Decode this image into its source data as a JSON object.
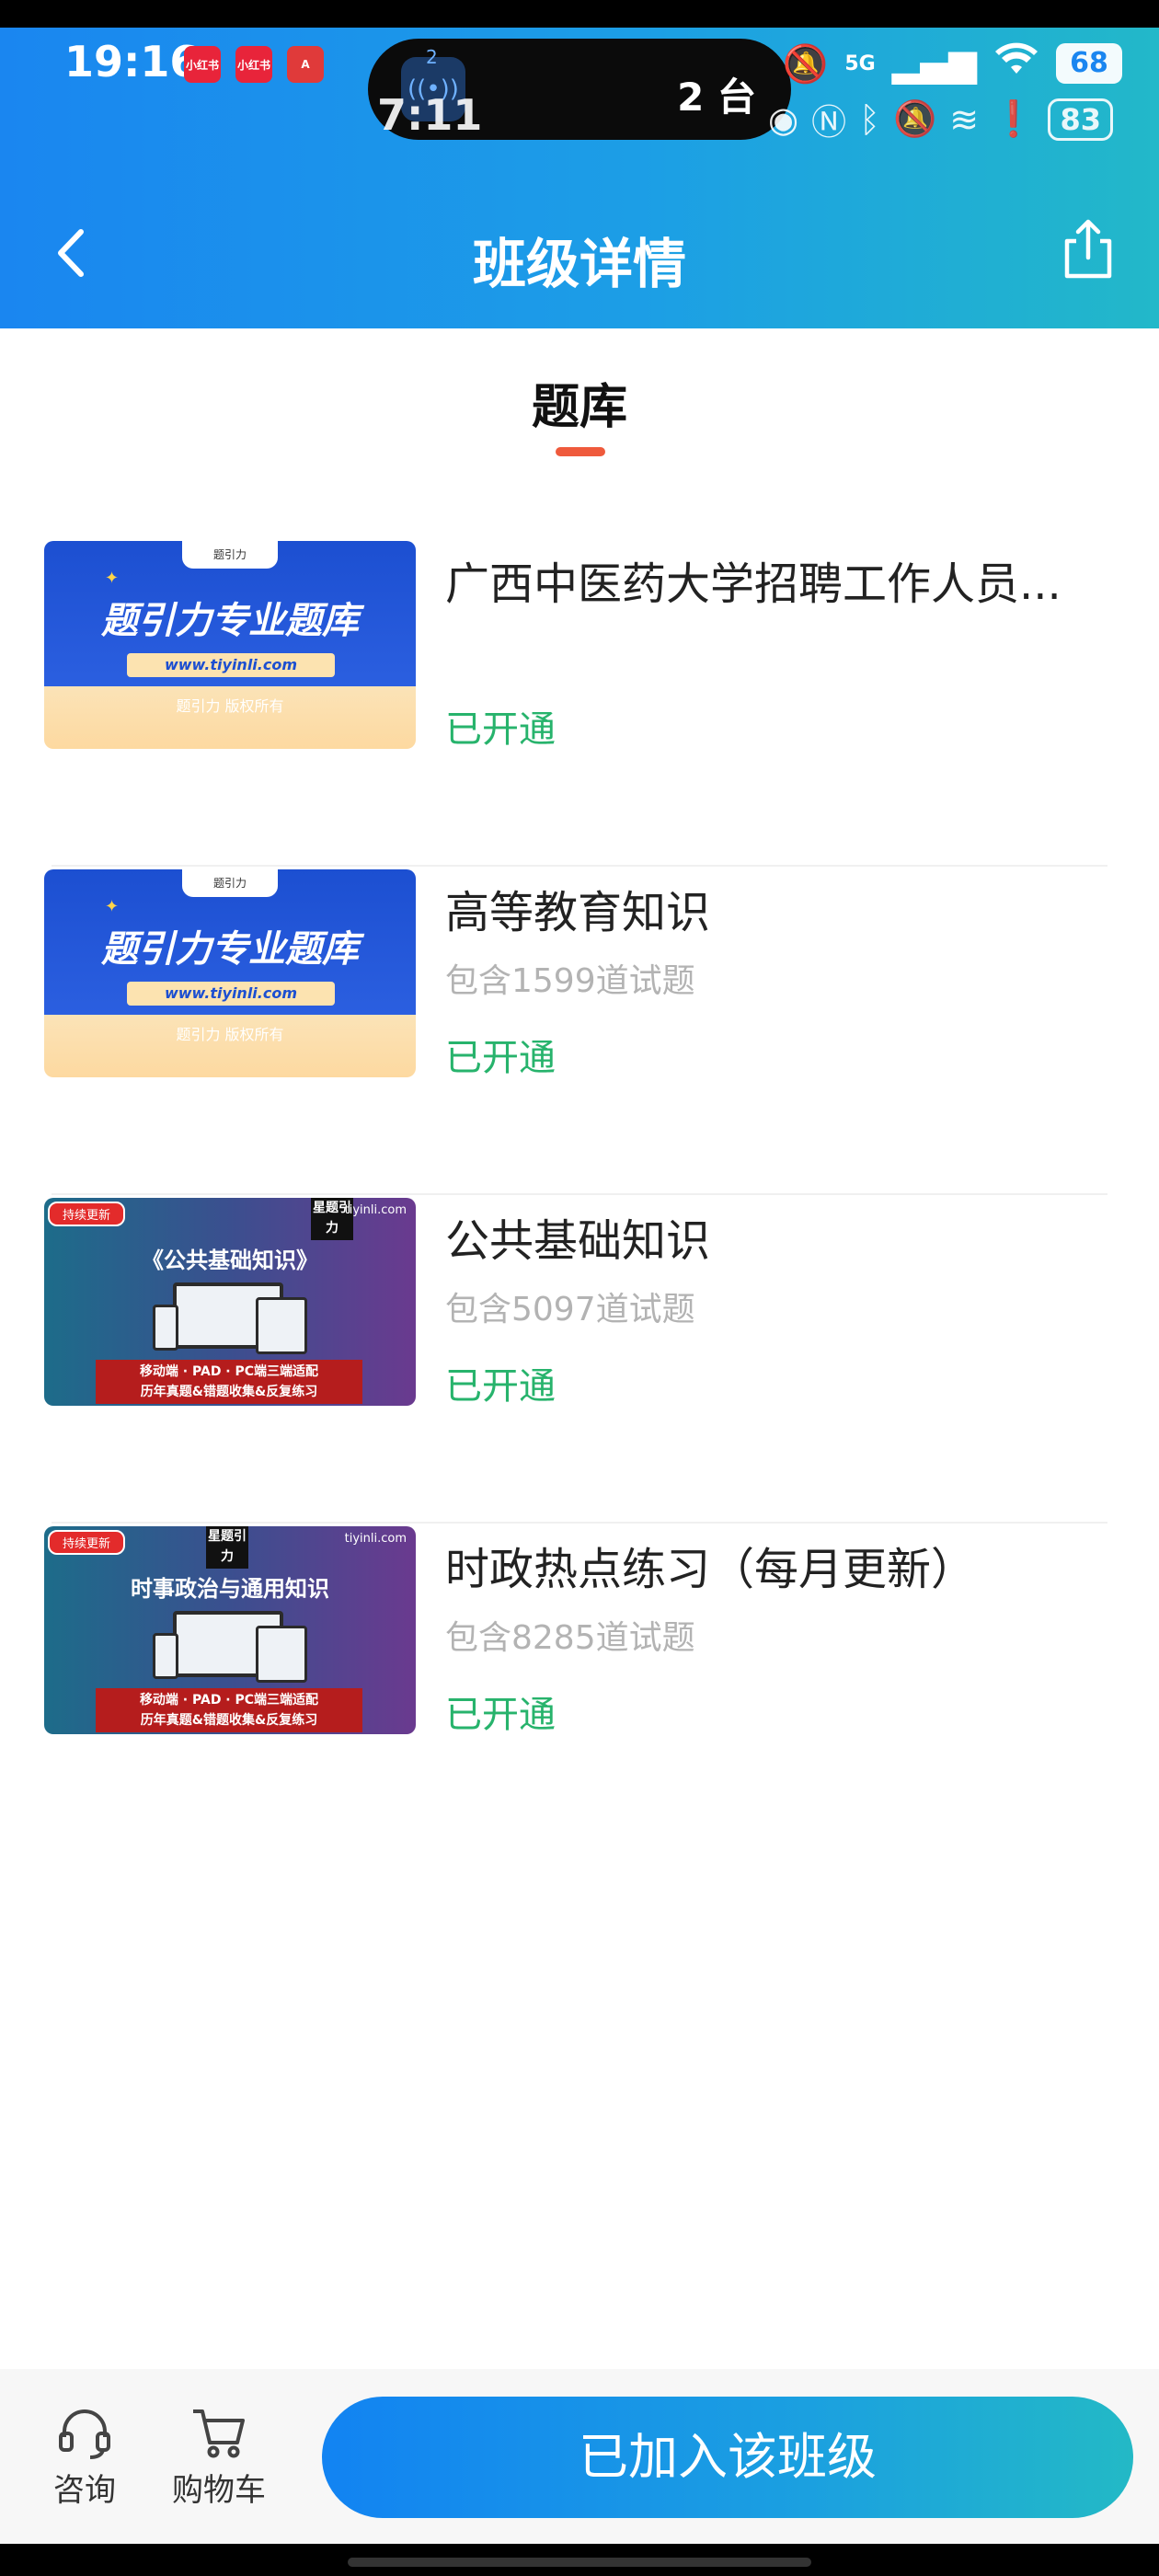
{
  "status_bar": {
    "time": "19:16",
    "app_icons": [
      "小红书",
      "小红书",
      "A"
    ],
    "island_badge": "2",
    "island_text": "2 台",
    "network": "5G",
    "battery": "68"
  },
  "ghost_status": {
    "time": "7:11",
    "battery": "83"
  },
  "nav": {
    "title": "班级详情"
  },
  "tab": {
    "label": "题库"
  },
  "thumbs": {
    "blue": {
      "top": "题引力",
      "title": "题引力专业题库",
      "url": "www.tiyinli.com",
      "footer": "题引力 版权所有"
    },
    "purple_a": {
      "badge": "持续更新",
      "logo": "星题引力",
      "site": "tiyinli.com",
      "title": "《公共基础知识》",
      "red_line1": "移动端 · PAD · PC端三端适配",
      "red_line2": "历年真题&错题收集&反复练习"
    },
    "purple_b": {
      "badge": "持续更新",
      "logo": "星题引力",
      "site": "tiyinli.com",
      "title": "时事政治与通用知识",
      "red_line1": "移动端 · PAD · PC端三端适配",
      "red_line2": "历年真题&错题收集&反复练习"
    }
  },
  "items": [
    {
      "title": "广西中医药大学招聘工作人员...",
      "subtitle": "",
      "status": "已开通"
    },
    {
      "title": "高等教育知识",
      "subtitle": "包含1599道试题",
      "status": "已开通"
    },
    {
      "title": "公共基础知识",
      "subtitle": "包含5097道试题",
      "status": "已开通"
    },
    {
      "title": "时政热点练习（每月更新）",
      "subtitle": "包含8285道试题",
      "status": "已开通"
    }
  ],
  "bottom": {
    "consult_label": "咨询",
    "cart_label": "购物车",
    "join_label": "已加入该班级"
  },
  "colors": {
    "header_start": "#1a86f0",
    "header_end": "#22b8c9",
    "status_green": "#27b36c",
    "tab_underline": "#ef5a3c"
  }
}
